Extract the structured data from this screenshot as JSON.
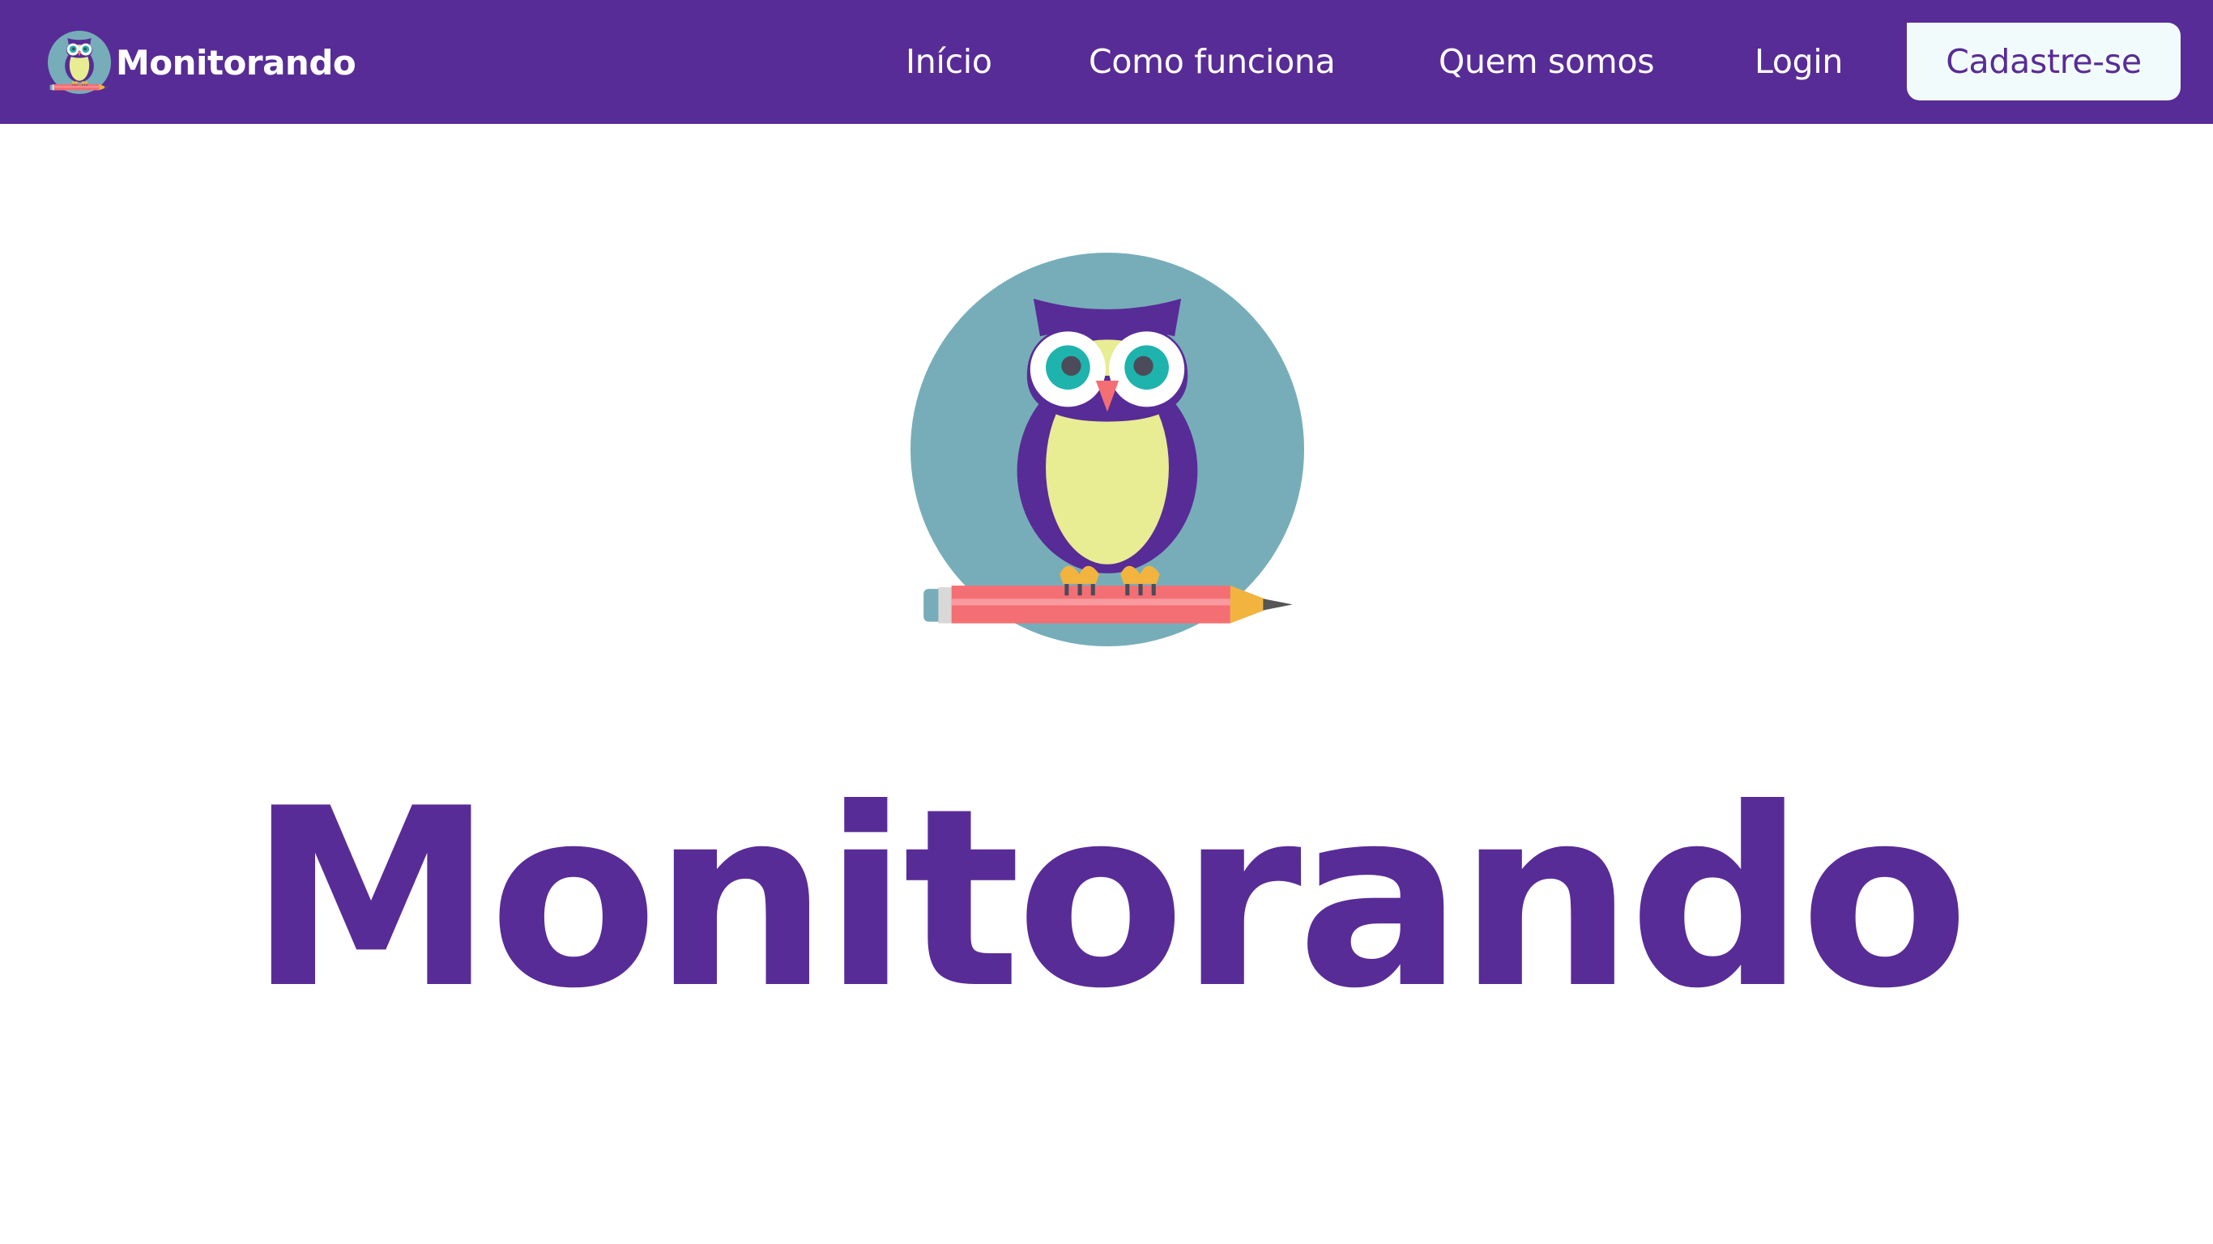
{
  "brand": {
    "name": "Monitorando",
    "logo_icon": "owl-on-pencil-icon"
  },
  "nav": {
    "items": [
      {
        "label": "Início"
      },
      {
        "label": "Como funciona"
      },
      {
        "label": "Quem somos"
      },
      {
        "label": "Login"
      }
    ],
    "cta_label": "Cadastre-se"
  },
  "hero": {
    "logo_icon": "owl-on-pencil-icon",
    "title": "Monitorando"
  },
  "colors": {
    "brand_purple": "#582c96",
    "cta_background": "#f2fbfb",
    "logo_circle": "#77adb9",
    "owl_belly": "#e8ec93",
    "owl_eye": "#1fb3ad",
    "pencil": "#f46f73",
    "pencil_tip": "#f2b43e"
  }
}
